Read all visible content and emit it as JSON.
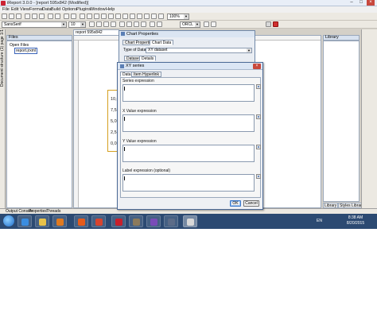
{
  "window": {
    "title": "iReport 3.0.0 - [report 595x842 (Modified)]"
  },
  "menu": [
    "File",
    "Edit",
    "View",
    "Format",
    "Data",
    "Build",
    "Options",
    "Plugins",
    "Window",
    "Help"
  ],
  "toolbar": {
    "font_value": "SansSerif",
    "size_value": "10",
    "zoom_value": "100%",
    "ireport_value": "ORCL"
  },
  "side_tab": {
    "label": "Document structure (1) page 1/1"
  },
  "files_panel": {
    "header": "Files",
    "open_files": "Open Files",
    "file": "report.jrxml"
  },
  "editor": {
    "tab": "report 595x842"
  },
  "report_chart": {
    "ticks": [
      "10,0",
      "7,5",
      "5,0",
      "2,5",
      "0,0"
    ]
  },
  "library": {
    "header": "Library",
    "tabs": [
      "Library",
      "Styles Library"
    ]
  },
  "bottom_tabs": [
    "Output Console",
    "Properties",
    "Threads"
  ],
  "chart_properties": {
    "title": "Chart Properties",
    "tabs": [
      "Chart Properties",
      "Chart Data"
    ],
    "type_label": "Type of Dataset",
    "type_value": "XY dataset",
    "subtabs": [
      "Dataset",
      "Details"
    ]
  },
  "xy_series": {
    "title": "XY series",
    "tabs": [
      "Data",
      "Item Hyperlink"
    ],
    "fields": [
      "Series expression",
      "X Value expression",
      "Y Value expression",
      "Label expression (optional)"
    ],
    "ok": "OK",
    "cancel": "Cancel"
  },
  "tray": {
    "lang": "EN",
    "time": "8:38 AM",
    "date": "8/20/2015"
  }
}
